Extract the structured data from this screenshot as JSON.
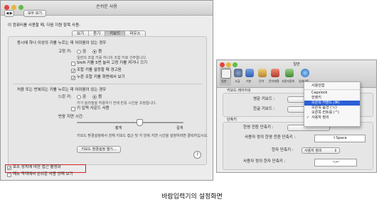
{
  "accessibility_window": {
    "title": "손쉬운 사용",
    "show_all": "모두 보기",
    "intro": "이 컴퓨터를 사용할 때, 다음 지원 항목 사용:",
    "tabs": [
      "보기",
      "듣기",
      "키보드",
      "마우스"
    ],
    "selected_tab": "키보드",
    "section1_title": "동시에 하나 이상의 키를 누르는 데 어려움이 있는 경우",
    "sticky_label": "고정 키:",
    "on": "켬",
    "off": "끔",
    "sticky_desc": "일련의 조합 키를 하나의 조합 키로 간주합니다.",
    "shift5": "Shift 키를 5번 눌러 고정 키를 켜거나 끄기",
    "beep": "조합 키를 설정할 때 경고음",
    "display_keys": "누른 조합 키를 화면에서 보기",
    "section2_title": "처음 또는 반복되는 키를 누르는 데 어려움이 있는 경우",
    "slow_label": "느린 키:",
    "slow_desc": "키가 눌러짐을 허용하기 전에 반응 시간을 조정합니다.",
    "typing_sound": "키 입력 사운드 사용",
    "delay_label": "반응 지연 시간:",
    "delay_short": "짧게",
    "delay_long": "길게",
    "bottom_desc": "키보드 환경설정에서 전체 키보드 접근 및 키 반복 지연 시간을 설정하려면 클릭하십시오.",
    "keyboard_prefs_button": "키보드 환경설정 열기...",
    "help": "?",
    "assistive": "보조 장치에 대한 접근 활성화",
    "menu_status": "메뉴 막대에서 손쉬운 사용 상태 보기"
  },
  "general_window": {
    "title": "일반",
    "toolbar": [
      "일반",
      "고급",
      "기본",
      "단어",
      "문자변환",
      "사용자정의",
      "업데이트"
    ],
    "keyboard_layout": "키보드 레이아웃",
    "english_kb": "영문 키보드 :",
    "korean_kb": "한글 키보드 :",
    "shortcuts": "단축키",
    "hanyoung_label": "한영 전환 단축키 :",
    "custom_hanyoung": "사용자 정의 한영 전환 단축키 :",
    "custom_hanyoung_value": "⇧Space",
    "hanja_label": "한자 단축키 :",
    "hanja_value": "사용자 정의",
    "custom_hanja": "사용자 정의 한자 단축키 :",
    "custom_hanja_value": "⌥↩"
  },
  "dropdown_menu": {
    "items": [
      "사용안함",
      "Capslock",
      "한영키",
      "오른쪽 커맨드 (⌘)",
      "오른쪽 옵션 (⌥)",
      "오른쪽 컨트롤 (^)",
      "사용자 정의"
    ],
    "highlighted": "오른쪽 커맨드 (⌘)",
    "checked": "사용자 정의"
  },
  "caption": "바람입력기의 설정화면"
}
